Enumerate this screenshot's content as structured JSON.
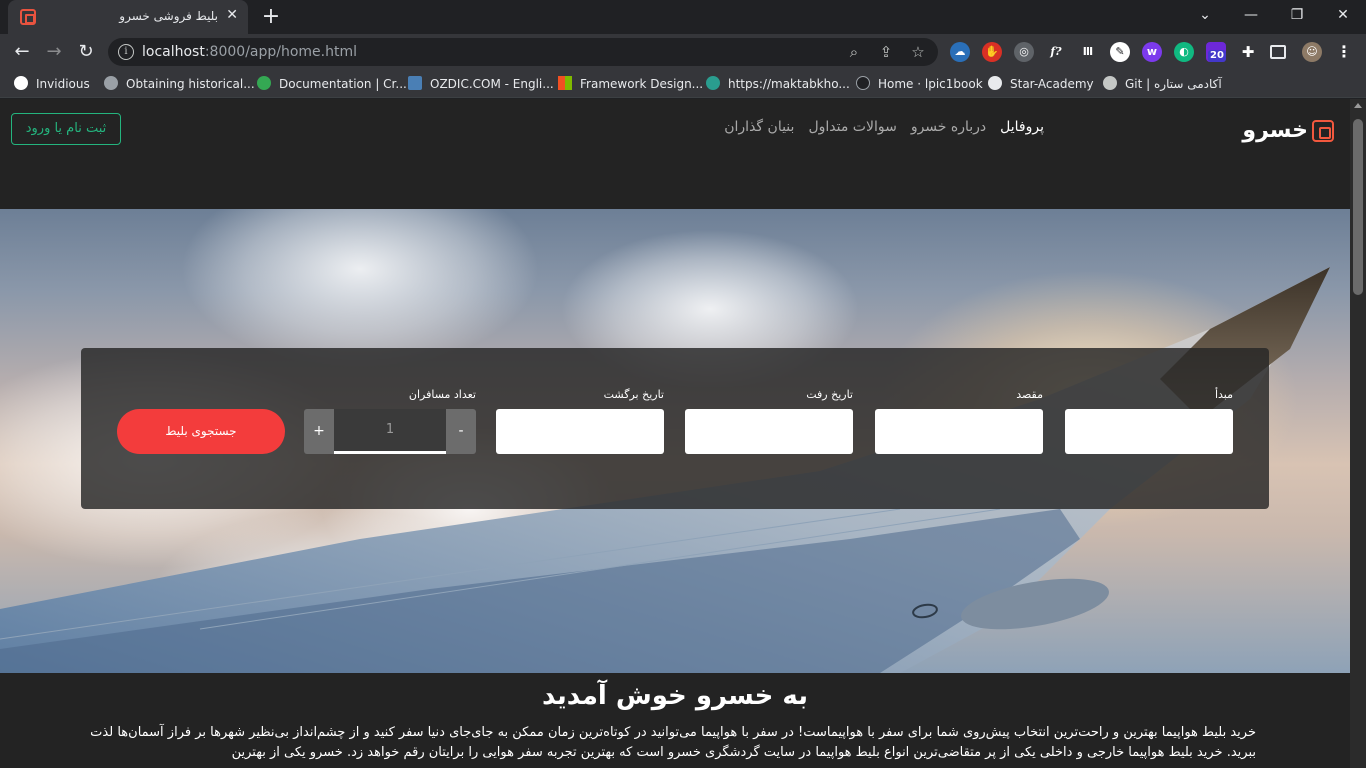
{
  "browser": {
    "tab_title": "بلیط فروشی خسرو",
    "tab_close": "✕",
    "new_tab": "+",
    "window_buttons": [
      "⌄",
      "—",
      "❐",
      "✕"
    ],
    "url_host": "localhost",
    "url_rest": ":8000/app/home.html",
    "extension_badge": "20",
    "bookmarks": [
      "Invidious",
      "Obtaining historical...",
      "Documentation | Cr...",
      "OZDIC.COM - Engli...",
      "Framework Design...",
      "https://maktabkho...",
      "Home · lpic1book",
      "Star-Academy",
      "Git | آکادمی ستاره"
    ]
  },
  "site": {
    "logo": "خسرو",
    "menu": [
      {
        "label": "پروفایل",
        "active": true
      },
      {
        "label": "درباره خسرو",
        "active": false
      },
      {
        "label": "سوالات متداول",
        "active": false
      },
      {
        "label": "بنیان گذاران",
        "active": false
      }
    ],
    "auth_button": "ثبت نام یا ورود"
  },
  "search": {
    "origin_label": "مبدأ",
    "destination_label": "مقصد",
    "depart_label": "تاریخ رفت",
    "return_label": "تاریخ برگشت",
    "passengers_label": "تعداد مسافران",
    "passengers_value": "1",
    "minus": "-",
    "plus": "+",
    "submit": "جستجوی بلیط"
  },
  "welcome": {
    "title": "به خسرو خوش آمدید",
    "text": "خرید بلیط هواپیما بهترین و راحت‌ترین انتخاب پیش‌روی شما برای سفر با هواپیماست! در سفر با هواپیما می‌توانید در کوتاه‌ترین زمان ممکن به جای‌جای دنیا سفر کنید و از چشم‌انداز بی‌نظیر شهرها بر فراز آسمان‌ها لذت ببرید. خرید بلیط هواپیما خارجی و داخلی یکی از پر متقاضی‌ترین انواع بلیط هواپیما در سایت گردشگری خسرو است که بهترین تجربه سفر هوایی را برایتان رقم خواهد زد. خسرو یکی از بهترین"
  },
  "colors": {
    "accent_red": "#f33c3c",
    "accent_green": "#24b47e",
    "logo_orange": "#f2583e"
  }
}
